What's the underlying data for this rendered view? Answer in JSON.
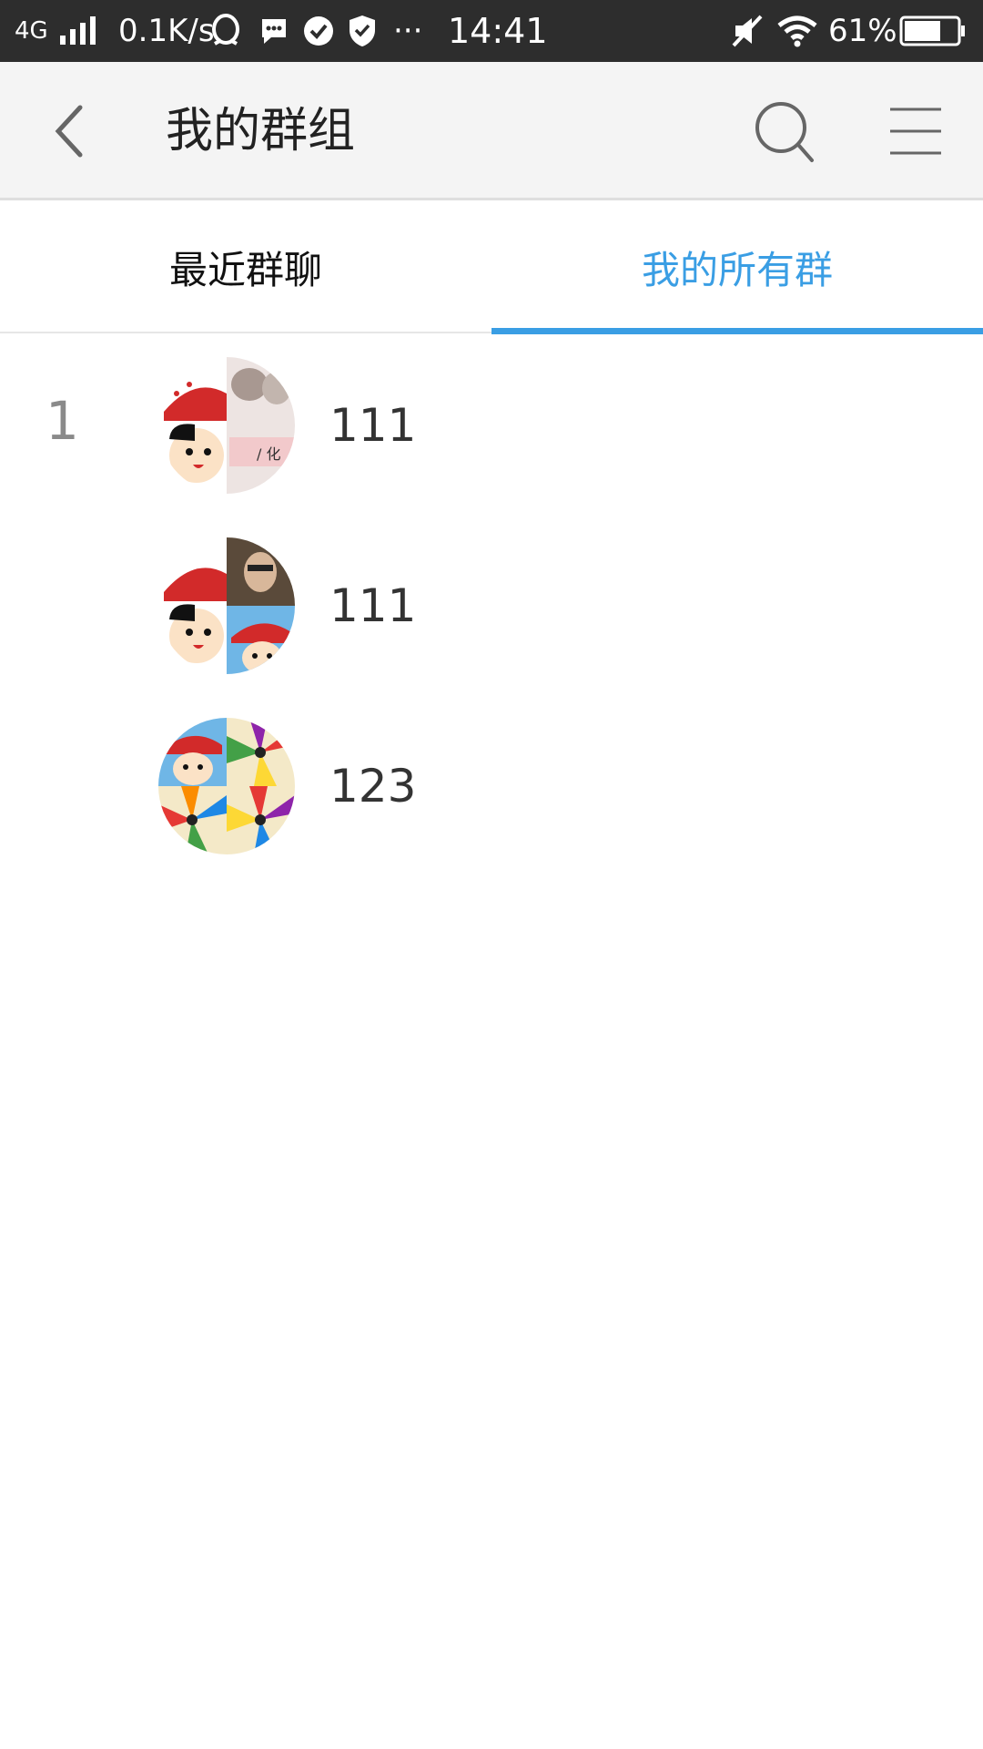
{
  "status_bar": {
    "network": "4G",
    "speed": "0.1K/s",
    "time": "14:41",
    "battery": "61%",
    "more": "···"
  },
  "header": {
    "title": "我的群组",
    "back_icon": "chevron-left-icon",
    "search_icon": "search-icon",
    "menu_icon": "hamburger-menu-icon"
  },
  "tabs": [
    {
      "label": "最近群聊",
      "active": false
    },
    {
      "label": "我的所有群",
      "active": true
    }
  ],
  "accent_color": "#3a9ee4",
  "groups": [
    {
      "index": "1",
      "name": "111"
    },
    {
      "index": "",
      "name": "111"
    },
    {
      "index": "",
      "name": "123"
    }
  ]
}
